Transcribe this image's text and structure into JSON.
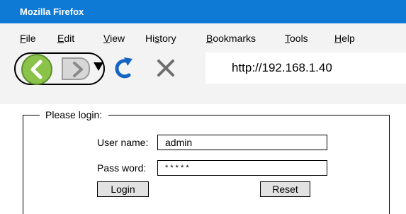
{
  "window": {
    "title": "Mozilla Firefox"
  },
  "menu": [
    {
      "pre": "",
      "ul": "F",
      "post": "ile"
    },
    {
      "pre": "",
      "ul": "E",
      "post": "dit"
    },
    {
      "pre": "",
      "ul": "V",
      "post": "iew"
    },
    {
      "pre": "Hi",
      "ul": "s",
      "post": "tory"
    },
    {
      "pre": "",
      "ul": "B",
      "post": "ookmarks"
    },
    {
      "pre": "",
      "ul": "T",
      "post": "ools"
    },
    {
      "pre": "",
      "ul": "H",
      "post": "elp"
    }
  ],
  "toolbar": {
    "url": "http://192.168.1.40",
    "icons": {
      "back": "back-arrow-icon",
      "forward": "forward-arrow-icon",
      "dropdown": "history-dropdown-icon",
      "reload": "reload-icon",
      "stop": "stop-icon"
    }
  },
  "login": {
    "legend": "Please login:",
    "username_label": "User name:",
    "username_value": "admin",
    "password_label": "Pass word:",
    "password_value": "* * * * *",
    "login_button": "Login",
    "reset_button": "Reset"
  },
  "colors": {
    "titlebar": "#0f7ad6",
    "back_button": "#8bc34a",
    "reload_icon": "#1565c0",
    "stop_icon": "#6e6e6e"
  }
}
